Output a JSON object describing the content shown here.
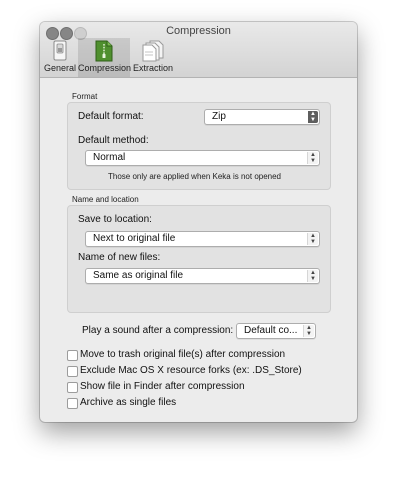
{
  "window": {
    "title": "Compression"
  },
  "toolbar": {
    "items": [
      {
        "label": "General"
      },
      {
        "label": "Compression"
      },
      {
        "label": "Extraction"
      }
    ]
  },
  "format": {
    "group_label": "Format",
    "default_format_label": "Default format:",
    "default_format_value": "Zip",
    "default_method_label": "Default method:",
    "default_method_value": "Normal",
    "note": "Those only are applied when Keka is not opened"
  },
  "location": {
    "group_label": "Name and location",
    "save_to_label": "Save to location:",
    "save_to_value": "Next to original file",
    "name_label": "Name of new files:",
    "name_value": "Same as original file"
  },
  "sound": {
    "label": "Play a sound after a compression:",
    "value": "Default co..."
  },
  "options": [
    {
      "label": "Move to trash original file(s) after compression",
      "checked": false
    },
    {
      "label": "Exclude Mac OS X resource forks (ex: .DS_Store)",
      "checked": false
    },
    {
      "label": "Show file in Finder after compression",
      "checked": false
    },
    {
      "label": "Archive as single files",
      "checked": false
    }
  ],
  "colors": {
    "window_bg": "#ececec",
    "group_bg": "#e2e2e2",
    "selected_icon": "#4f8f2e"
  },
  "icons": {
    "general": "switch-icon",
    "compression": "zip-document-icon",
    "extraction": "documents-icon"
  }
}
